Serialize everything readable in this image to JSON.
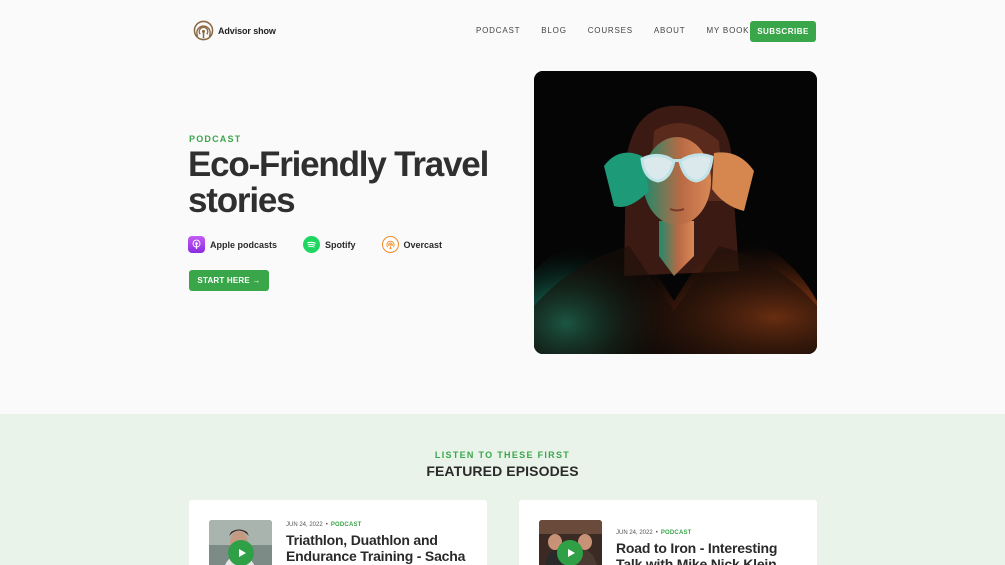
{
  "brand": {
    "name": "Advisor show"
  },
  "nav": {
    "items": [
      {
        "label": "PODCAST"
      },
      {
        "label": "BLOG"
      },
      {
        "label": "COURSES"
      },
      {
        "label": "ABOUT"
      },
      {
        "label": "MY BOOK"
      }
    ],
    "subscribe_label": "SUBSCRIBE"
  },
  "hero": {
    "eyebrow": "PODCAST",
    "title": "Eco-Friendly Travel stories",
    "platforms": [
      {
        "label": "Apple podcasts",
        "icon": "apple-podcasts-icon"
      },
      {
        "label": "Spotify",
        "icon": "spotify-icon"
      },
      {
        "label": "Overcast",
        "icon": "overcast-icon"
      }
    ],
    "cta_label": "START HERE →"
  },
  "featured": {
    "eyebrow": "LISTEN TO THESE FIRST",
    "title": "FEATURED EPISODES",
    "episodes": [
      {
        "date": "JUN 24, 2022",
        "tag": "PODCAST",
        "title": "Triathlon, Duathlon and Endurance Training - Sacha"
      },
      {
        "date": "JUN 24, 2022",
        "tag": "PODCAST",
        "title": "Road to Iron - Interesting Talk with Mike Nick Klein"
      }
    ]
  },
  "colors": {
    "accent": "#3aa64a",
    "background": "#fafafa",
    "featured_bg": "#eaf3ea",
    "text": "#2a2a2a"
  }
}
